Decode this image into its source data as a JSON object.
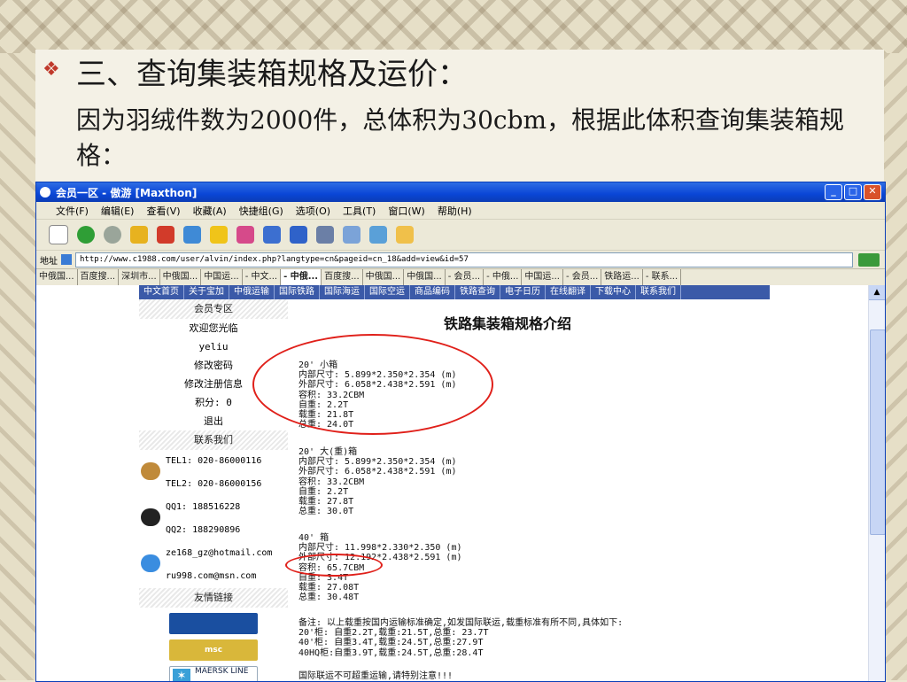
{
  "slide": {
    "bullet": "❖",
    "heading": "三、查询集装箱规格及运价：",
    "subtext": "因为羽绒件数为2000件，总体积为30cbm，根据此体积查询集装箱规格："
  },
  "browser": {
    "title": "会员一区 - 傲游 [Maxthon]",
    "window_buttons": {
      "min": "_",
      "max": "□",
      "close": "✕"
    },
    "menu": [
      "文件(F)",
      "编辑(E)",
      "查看(V)",
      "收藏(A)",
      "快捷组(G)",
      "选项(O)",
      "工具(T)",
      "窗口(W)",
      "帮助(H)"
    ],
    "toolbar_icons": [
      "new-page-icon",
      "back-icon",
      "forward-icon",
      "refresh-icon",
      "stop-icon",
      "home-icon",
      "favorites-icon",
      "translate-icon",
      "window-icon",
      "undo-icon",
      "tools-icon",
      "list-icon",
      "chart-icon",
      "folder-icon"
    ],
    "address_label": "地址",
    "address_url": "http://www.c1988.com/user/alvin/index.php?langtype=cn&pageid=cn_18&add=view&id=57",
    "tabs": [
      "中俄国...",
      "百度搜...",
      "深圳市...",
      "中俄国...",
      "中国运...",
      "- 中文...",
      "- 中俄...",
      "百度搜...",
      "中俄国...",
      "中俄国...",
      "- 会员...",
      "- 中俄...",
      "中国运...",
      "- 会员...",
      "铁路运...",
      "- 联系..."
    ],
    "active_tab_index": 6
  },
  "site": {
    "nav": [
      "中文首页",
      "关于宝加",
      "中俄运输",
      "国际铁路",
      "国际海运",
      "国际空运",
      "商品编码",
      "铁路查询",
      "电子日历",
      "在线翻译",
      "下载中心",
      "联系我们"
    ],
    "sidebar": {
      "member_head": "会员专区",
      "welcome": "欢迎您光临",
      "username": "yeliu",
      "change_password": "修改密码",
      "change_info": "修改注册信息",
      "points": "积分: 0",
      "logout": "退出",
      "contact_head": "联系我们",
      "tel1": "TEL1: 020-86000116",
      "tel2": "TEL2: 020-86000156",
      "qq1": "QQ1:  188516228",
      "qq2": "QQ2:  188290896",
      "email": "ze168_gz@hotmail.com",
      "msn": "ru998.com@msn.com",
      "links_head": "友情链接",
      "msc_logo": "msc",
      "maersk_logo": "MAERSK LINE"
    },
    "page_title": "铁路集装箱规格介绍",
    "containers": [
      {
        "lines": [
          "20' 小箱",
          "内部尺寸: 5.899*2.350*2.354 (m)",
          "外部尺寸: 6.058*2.438*2.591 (m)",
          "容积: 33.2CBM",
          "自重: 2.2T",
          "载重: 21.8T",
          "总重: 24.0T"
        ]
      },
      {
        "lines": [
          "20' 大(重)箱",
          "内部尺寸: 5.899*2.350*2.354 (m)",
          "外部尺寸: 6.058*2.438*2.591 (m)",
          "容积: 33.2CBM",
          "自重: 2.2T",
          "载重: 27.8T",
          "总重: 30.0T"
        ]
      },
      {
        "lines": [
          "40'  箱",
          "内部尺寸: 11.998*2.330*2.350 (m)",
          "外部尺寸: 12.192*2.438*2.591 (m)",
          "容积: 65.7CBM",
          "自重: 3.4T",
          "载重: 27.08T",
          "总重: 30.48T"
        ]
      }
    ],
    "notes": [
      "备注: 以上载重按国内运输标准确定,如发国际联运,载重标准有所不同,具体如下:",
      "20'柜: 自重2.2T,载重:21.5T,总重: 23.7T",
      "40'柜: 自重3.4T,载重:24.5T,总重:27.9T",
      "40HQ柜:自重3.9T,载重:24.5T,总重:28.4T"
    ],
    "warning": "国际联运不可超重运输,请特别注意!!!"
  },
  "colors": {
    "highlight_ring": "#e0201a",
    "titlebar": "#0a46d6",
    "site_nav": "#3b5aa8"
  }
}
